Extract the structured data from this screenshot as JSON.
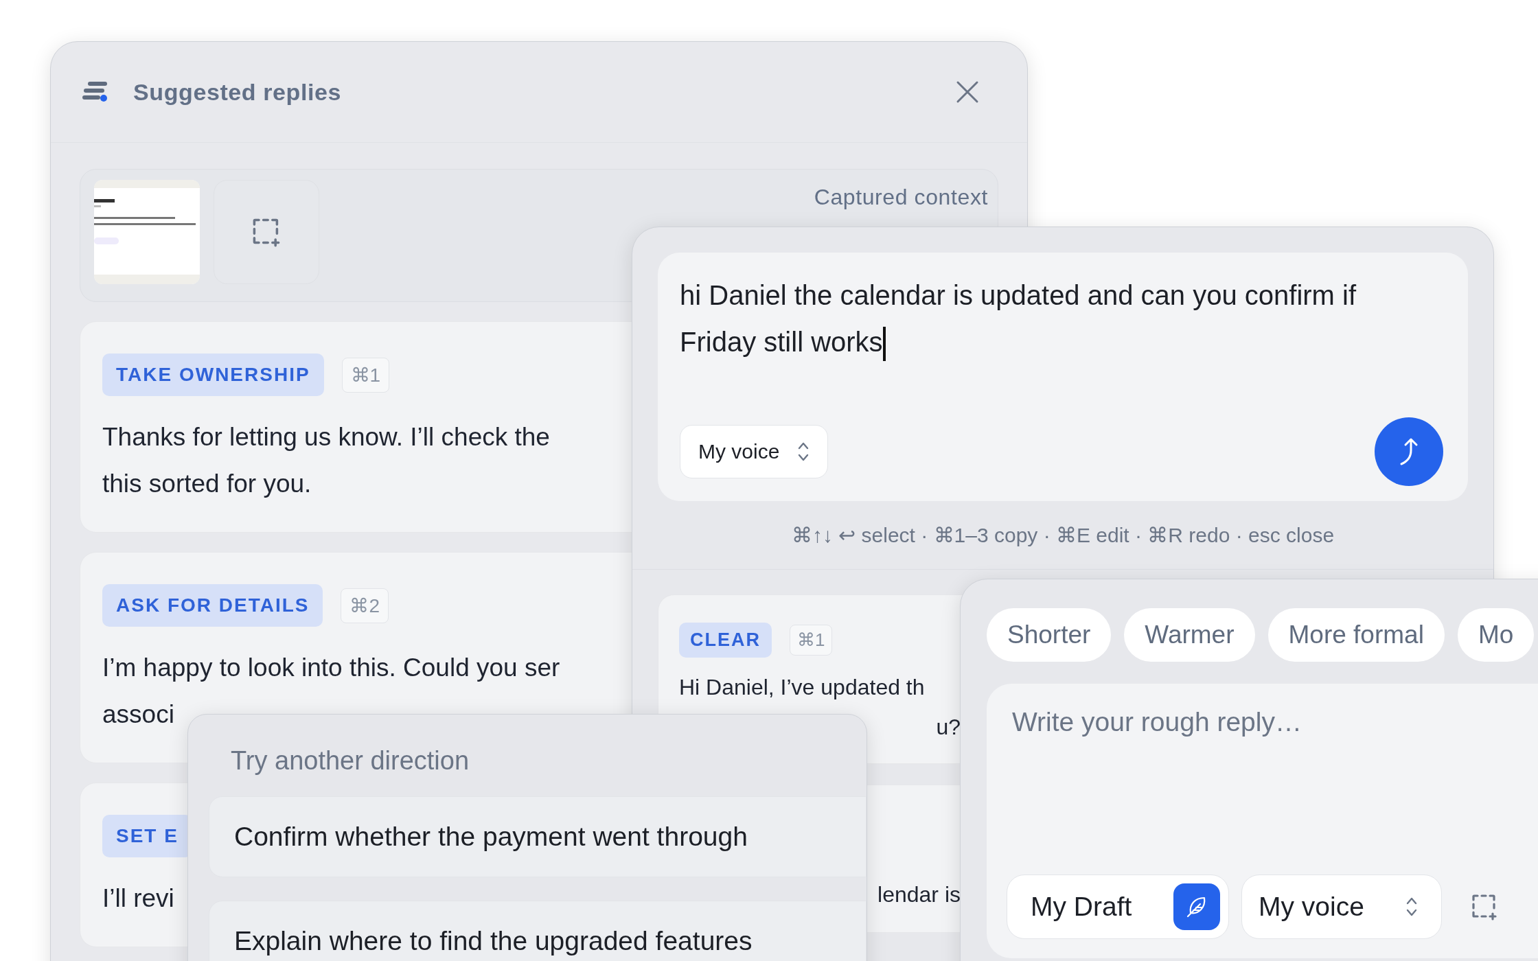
{
  "suggested_replies": {
    "title": "Suggested replies",
    "context": {
      "label": "Captured context"
    },
    "cards": [
      {
        "tag": "TAKE OWNERSHIP",
        "shortcut": "⌘1",
        "lines": [
          "Thanks for letting us know. I’ll check the",
          "this sorted for you."
        ]
      },
      {
        "tag": "ASK FOR DETAILS",
        "shortcut": "⌘2",
        "lines": [
          "I’m happy to look into this. Could you ser",
          "associ"
        ]
      },
      {
        "tag": "SET E",
        "lines": [
          "I’ll revi"
        ]
      }
    ]
  },
  "draft_window": {
    "value": "hi Daniel the calendar is updated and can you confirm if Friday still works",
    "focused": true,
    "voice": "My voice",
    "hints": "⌘↑↓ ↩ select · ⌘1–3 copy · ⌘E edit · ⌘R redo · esc close",
    "cards": [
      {
        "tag": "CLEAR",
        "shortcut": "⌘1",
        "lines": [
          "Hi Daniel, I’ve updated th",
          "u?"
        ]
      },
      {
        "lines": [
          "lendar is"
        ]
      }
    ]
  },
  "directions": {
    "title": "Try another direction",
    "options": [
      "Confirm whether the payment went through",
      "Explain where to find the upgraded features"
    ]
  },
  "composer": {
    "chips": [
      "Shorter",
      "Warmer",
      "More formal",
      "Mo"
    ],
    "placeholder": "Write your rough reply…",
    "draft_label": "My Draft",
    "voice": "My voice"
  }
}
